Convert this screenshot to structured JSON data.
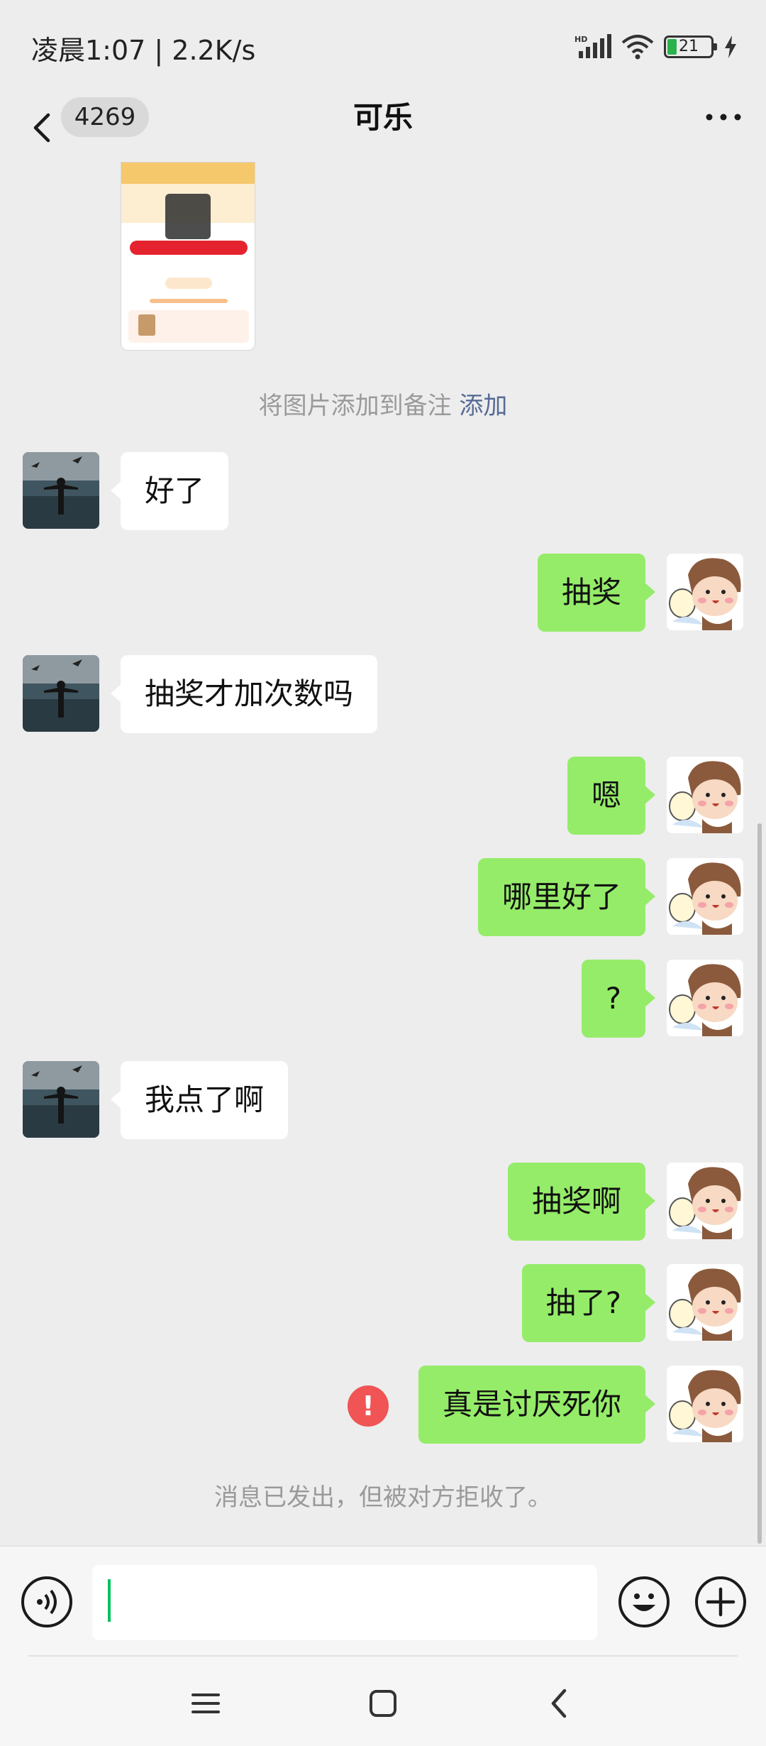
{
  "status_bar": {
    "time": "凌晨1:07 | 2.2K/s",
    "battery": "21",
    "icons": [
      "hd-signal-icon",
      "wifi-icon",
      "battery-icon",
      "charging-icon"
    ]
  },
  "nav": {
    "unread_count": "4269",
    "title": "可乐",
    "icons": [
      "back-icon",
      "more-icon"
    ]
  },
  "notice": {
    "text": "将图片添加到备注 ",
    "link": "添加"
  },
  "messages": [
    {
      "side": "in",
      "text": "好了"
    },
    {
      "side": "out",
      "text": "抽奖"
    },
    {
      "side": "in",
      "text": "抽奖才加次数吗"
    },
    {
      "side": "out",
      "text": "嗯"
    },
    {
      "side": "out",
      "text": "哪里好了"
    },
    {
      "side": "out",
      "text": "?"
    },
    {
      "side": "in",
      "text": "我点了啊"
    },
    {
      "side": "out",
      "text": "抽奖啊"
    },
    {
      "side": "out",
      "text": "抽了?"
    },
    {
      "side": "out",
      "text": "真是讨厌死你",
      "failed": true
    }
  ],
  "rejected_notice": "消息已发出，但被对方拒收了。",
  "error_mark": "!",
  "input": {
    "value": "",
    "icons": [
      "voice-icon",
      "emoji-icon",
      "plus-icon"
    ]
  },
  "colors": {
    "outgoing_bubble": "#95ec69",
    "incoming_bubble": "#ffffff",
    "link": "#576b95",
    "error": "#f05454",
    "background": "#ededed"
  }
}
